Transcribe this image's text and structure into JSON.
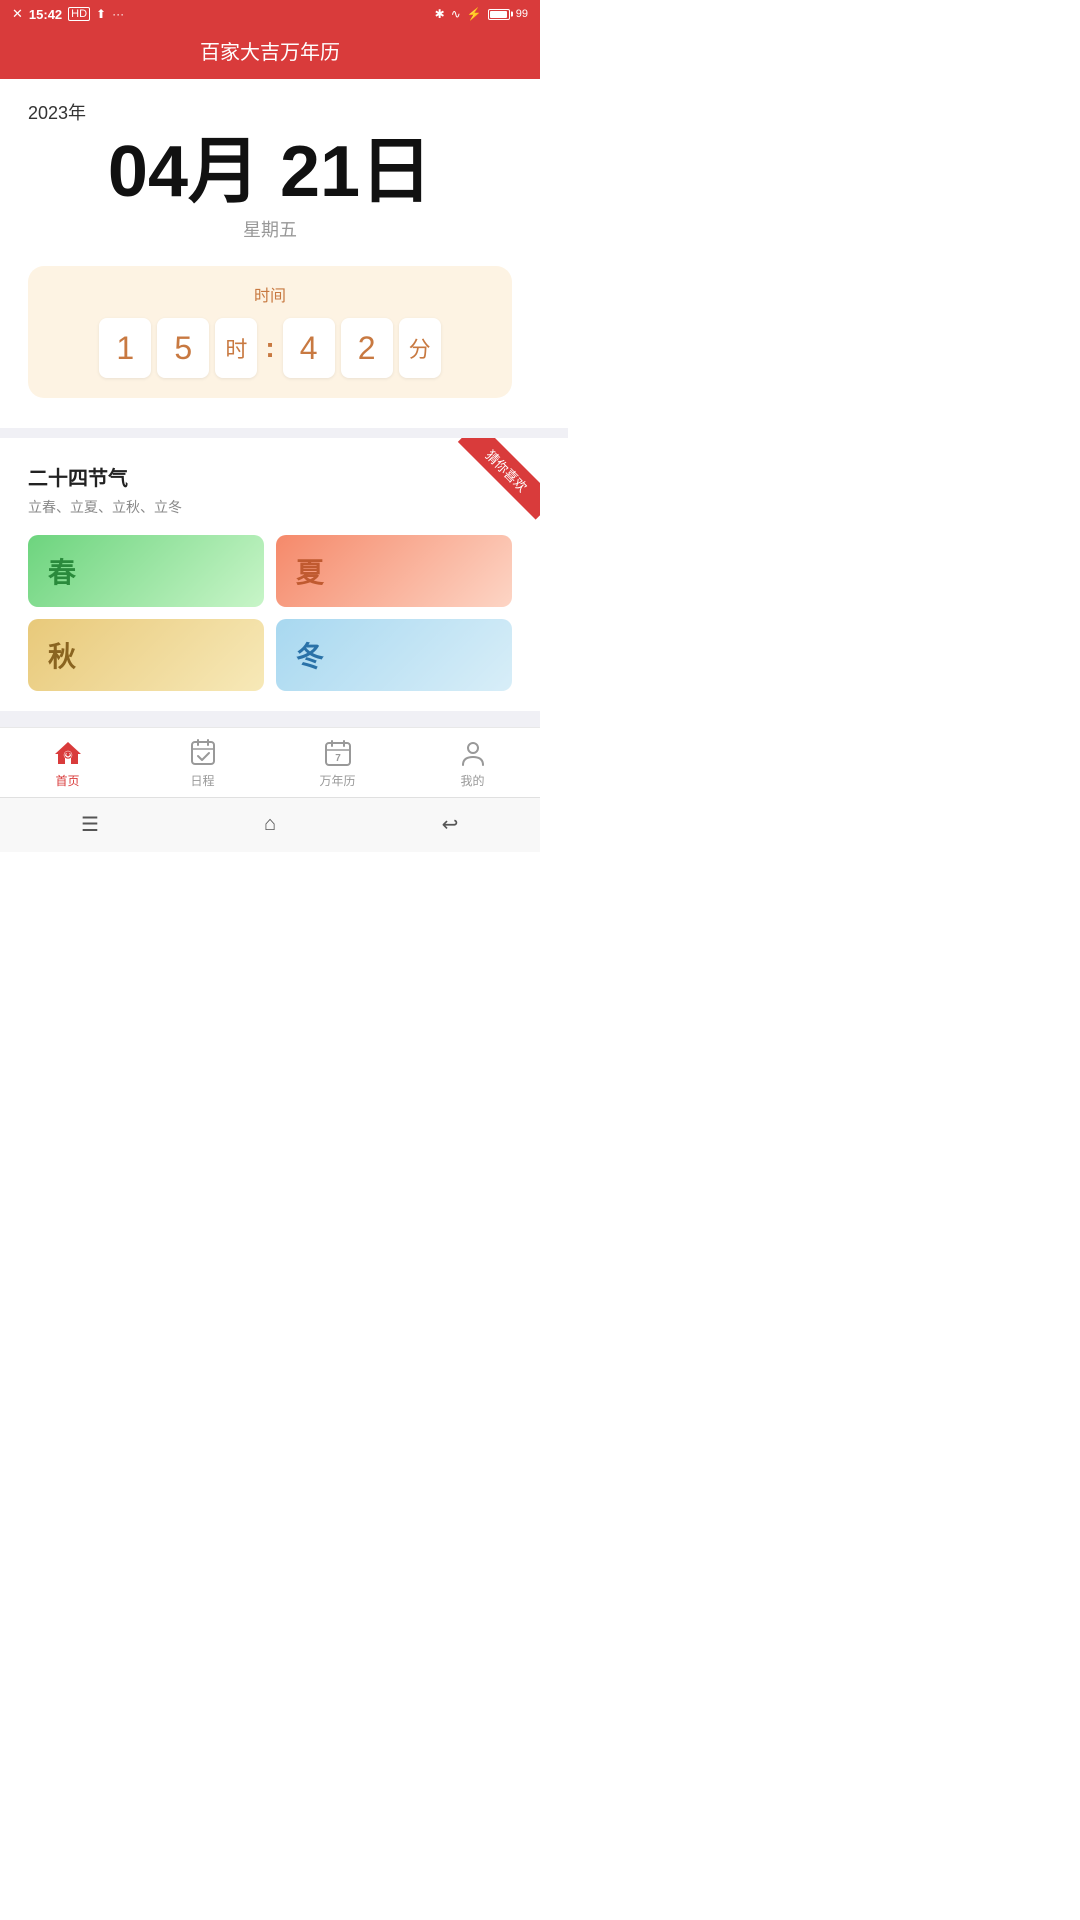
{
  "statusBar": {
    "time": "15:42",
    "batteryPercent": "99",
    "icons": [
      "notification-x-icon",
      "hd-icon",
      "signal-icon",
      "bluetooth-icon",
      "wifi-icon",
      "charge-icon"
    ]
  },
  "header": {
    "title": "百家大吉万年历"
  },
  "dateSection": {
    "year": "2023年",
    "monthDay": "04月 21日",
    "weekday": "星期五"
  },
  "timeSection": {
    "label": "时间",
    "hour1": "1",
    "hour2": "5",
    "hourUnit": "时",
    "colon": ":",
    "min1": "4",
    "min2": "2",
    "minUnit": "分"
  },
  "solarSection": {
    "ribbonText": "猜你喜欢",
    "title": "二十四节气",
    "subtitle": "立春、立夏、立秋、立冬",
    "seasons": [
      {
        "id": "spring",
        "label": "春",
        "class": "season-spring"
      },
      {
        "id": "summer",
        "label": "夏",
        "class": "season-summer"
      },
      {
        "id": "autumn",
        "label": "秋",
        "class": "season-autumn"
      },
      {
        "id": "winter",
        "label": "冬",
        "class": "season-winter"
      }
    ]
  },
  "bottomNav": {
    "items": [
      {
        "id": "home",
        "label": "首页",
        "active": true
      },
      {
        "id": "schedule",
        "label": "日程",
        "active": false
      },
      {
        "id": "calendar",
        "label": "万年历",
        "active": false
      },
      {
        "id": "profile",
        "label": "我的",
        "active": false
      }
    ]
  }
}
